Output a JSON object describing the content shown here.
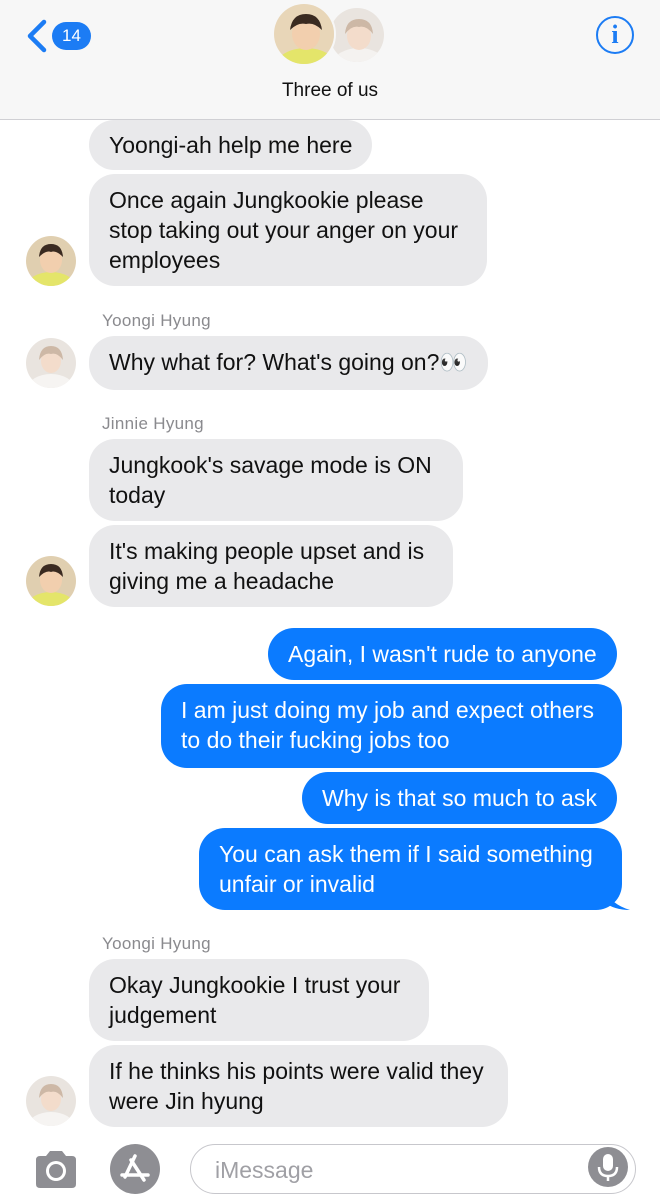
{
  "header": {
    "back_count": "14",
    "group_name": "Three of us",
    "info_label": "i"
  },
  "messages": [
    {
      "dir": "in",
      "text": "Yoongi-ah help me here"
    },
    {
      "dir": "in",
      "lines": [
        "Once again Jungkookie please",
        "stop taking out your anger on your",
        "employees"
      ]
    },
    {
      "sender": "Yoongi Hyung"
    },
    {
      "dir": "in",
      "text": "Why what for? What's going on?👀"
    },
    {
      "sender": "Jinnie Hyung"
    },
    {
      "dir": "in",
      "lines": [
        "Jungkook's savage mode is ON",
        "today"
      ]
    },
    {
      "dir": "in",
      "lines": [
        "It's making people upset and is",
        "giving me a headache"
      ]
    },
    {
      "dir": "out",
      "text": "Again, I wasn't rude to anyone"
    },
    {
      "dir": "out",
      "lines": [
        "I am just doing my job and expect others",
        "to do their fucking jobs too"
      ]
    },
    {
      "dir": "out",
      "text": "Why is that so much to ask"
    },
    {
      "dir": "out",
      "lines": [
        "You can ask them if I said something",
        "unfair or invalid"
      ]
    },
    {
      "sender": "Yoongi Hyung"
    },
    {
      "dir": "in",
      "lines": [
        "Okay Jungkookie I trust your",
        "judgement"
      ]
    },
    {
      "dir": "in",
      "lines": [
        "If he thinks his points were valid they",
        "were Jin hyung"
      ]
    }
  ],
  "senders": {
    "s1": "Yoongi Hyung",
    "s2": "Jinnie Hyung",
    "s3": "Yoongi Hyung"
  },
  "bubbles": {
    "b1": "Yoongi-ah help me here",
    "b2_l1": "Once again Jungkookie please",
    "b2_l2": "stop taking out your anger on your",
    "b2_l3": "employees",
    "b3": "Why what for? What's going on?👀",
    "b4_l1": "Jungkook's savage mode is ON",
    "b4_l2": "today",
    "b5_l1": "It's making people upset and is",
    "b5_l2": "giving me a headache",
    "b6": "Again, I wasn't rude to anyone",
    "b7_l1": "I am just doing my job and expect others",
    "b7_l2": "to do their fucking jobs too",
    "b8": "Why is that so much to ask",
    "b9_l1": "You can ask them if I said something",
    "b9_l2": "unfair or invalid",
    "b10_l1": "Okay Jungkookie I trust your",
    "b10_l2": "judgement",
    "b11_l1": "If he thinks his points were valid they",
    "b11_l2": "were Jin hyung"
  },
  "composer": {
    "placeholder": "iMessage"
  },
  "icons": {
    "back": "chevron-left-icon",
    "info": "info-icon",
    "camera": "camera-icon",
    "apps": "app-store-icon",
    "mic": "microphone-icon"
  },
  "colors": {
    "accent": "#0b7bff",
    "incoming_bubble": "#e9e9eb",
    "header_bg": "#f7f7f7"
  }
}
